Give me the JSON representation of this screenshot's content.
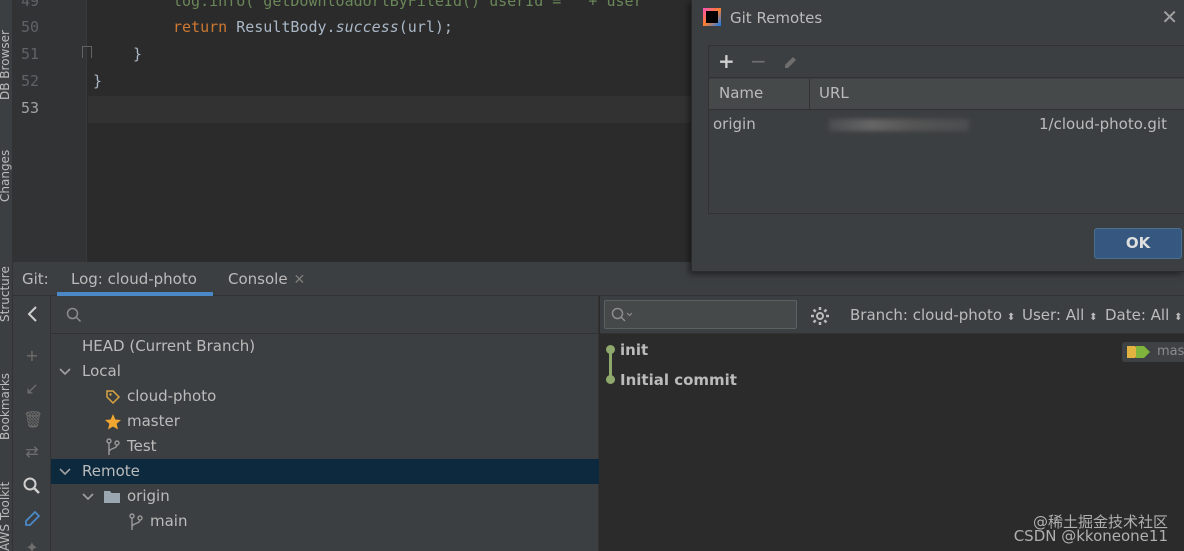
{
  "side_tabs": {
    "db_browser": "DB Browser",
    "changes": "Changes",
    "structure": "Structure",
    "bookmarks": "Bookmarks",
    "aws_toolkit": "AWS Toolkit"
  },
  "editor": {
    "line_numbers": [
      "49",
      "50",
      "51",
      "52",
      "53"
    ],
    "line49": "log.info(\"getDownloadUrlByFileId() userId = \" + user",
    "line50_kw": "return",
    "line50_obj": "ResultBody.",
    "line50_fn": "success",
    "line50_tail": "(url);",
    "line51": "}",
    "line52": "}"
  },
  "git_bar": {
    "label": "Git:",
    "tab_log": "Log: cloud-photo",
    "tab_console": "Console"
  },
  "branches": {
    "head": "HEAD (Current Branch)",
    "local": "Local",
    "local_items": [
      "cloud-photo",
      "master",
      "Test"
    ],
    "remote": "Remote",
    "origin": "origin",
    "remote_items": [
      "main"
    ]
  },
  "log": {
    "filters": {
      "branch": "Branch: cloud-photo",
      "user": "User: All",
      "date": "Date: All"
    },
    "commits": [
      "init",
      "Initial commit"
    ],
    "ref_label": "mas"
  },
  "dialog": {
    "title": "Git Remotes",
    "col_name": "Name",
    "col_url": "URL",
    "remote_name": "origin",
    "remote_url_visible_a": "-.../kkone",
    "remote_url_visible_b": "1/cloud-photo.git",
    "ok_label": "OK"
  },
  "watermarks": {
    "line1": "@稀土掘金技术社区",
    "line2": "CSDN @kkoneone11"
  },
  "colors": {
    "accent": "#4a88c7",
    "selection": "#0d293e",
    "graph": "#8fa86b",
    "ok_button": "#365880"
  }
}
